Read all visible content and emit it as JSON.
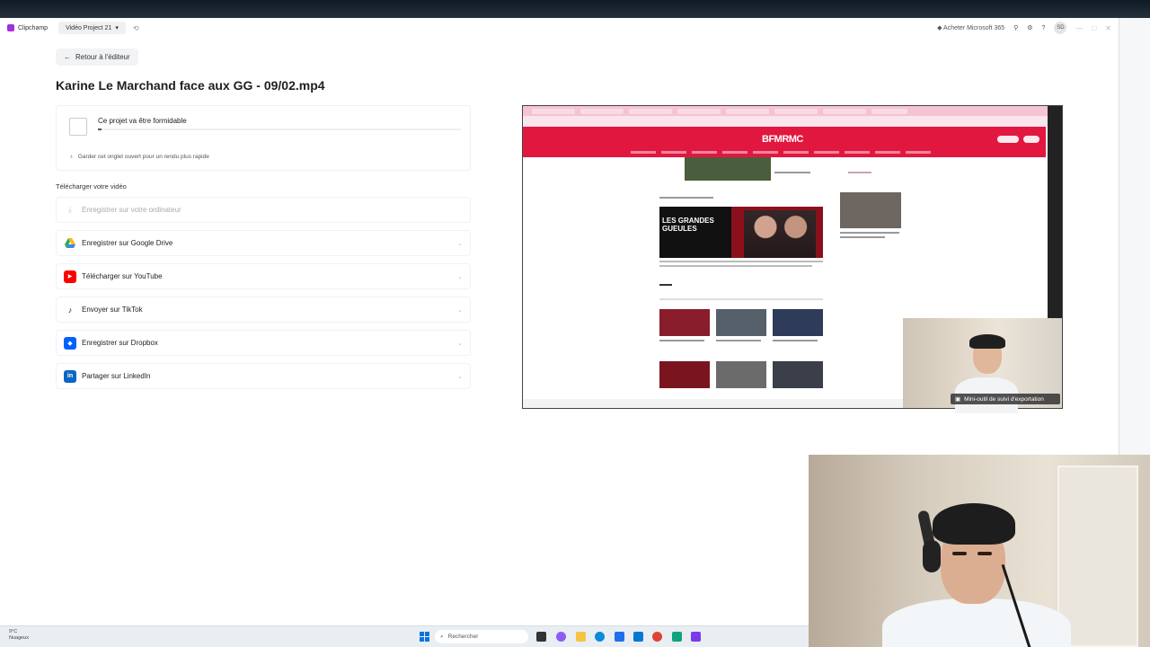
{
  "app": {
    "name": "Clipchamp",
    "project_selector": "Vidéo Project 21",
    "buy_label": "Acheter Microsoft 365",
    "avatar_initials": "SD"
  },
  "export_page": {
    "back_label": "Retour à l'éditeur",
    "title": "Karine Le Marchand face aux GG - 09/02.mp4",
    "progress_message": "Ce projet va être formidable",
    "progress_fraction": 0.01,
    "tip": "Garder cet onglet ouvert pour un rendu plus rapide",
    "download_heading": "Télécharger votre vidéo",
    "options": [
      {
        "label": "Enregistrer sur votre ordinateur",
        "icon": "download-icon",
        "disabled": true
      },
      {
        "label": "Enregistrer sur Google Drive",
        "icon": "google-drive-icon"
      },
      {
        "label": "Télécharger sur YouTube",
        "icon": "youtube-icon"
      },
      {
        "label": "Envoyer sur TikTok",
        "icon": "tiktok-icon"
      },
      {
        "label": "Enregistrer sur Dropbox",
        "icon": "dropbox-icon"
      },
      {
        "label": "Partager sur LinkedIn",
        "icon": "linkedin-icon"
      }
    ]
  },
  "preview": {
    "site_logo": "BFMRMC",
    "headline_image_text": "LES GRANDES GUEULES",
    "mini_tool_label": "Mini-outil de suivi d'exportation"
  },
  "taskbar": {
    "temperature": "9°C",
    "weather": "Nuageux",
    "search_placeholder": "Rechercher"
  },
  "colors": {
    "bfm_red": "#e2173f",
    "clipchamp_purple": "#7c3aed",
    "windows_blue": "#0a74da"
  }
}
